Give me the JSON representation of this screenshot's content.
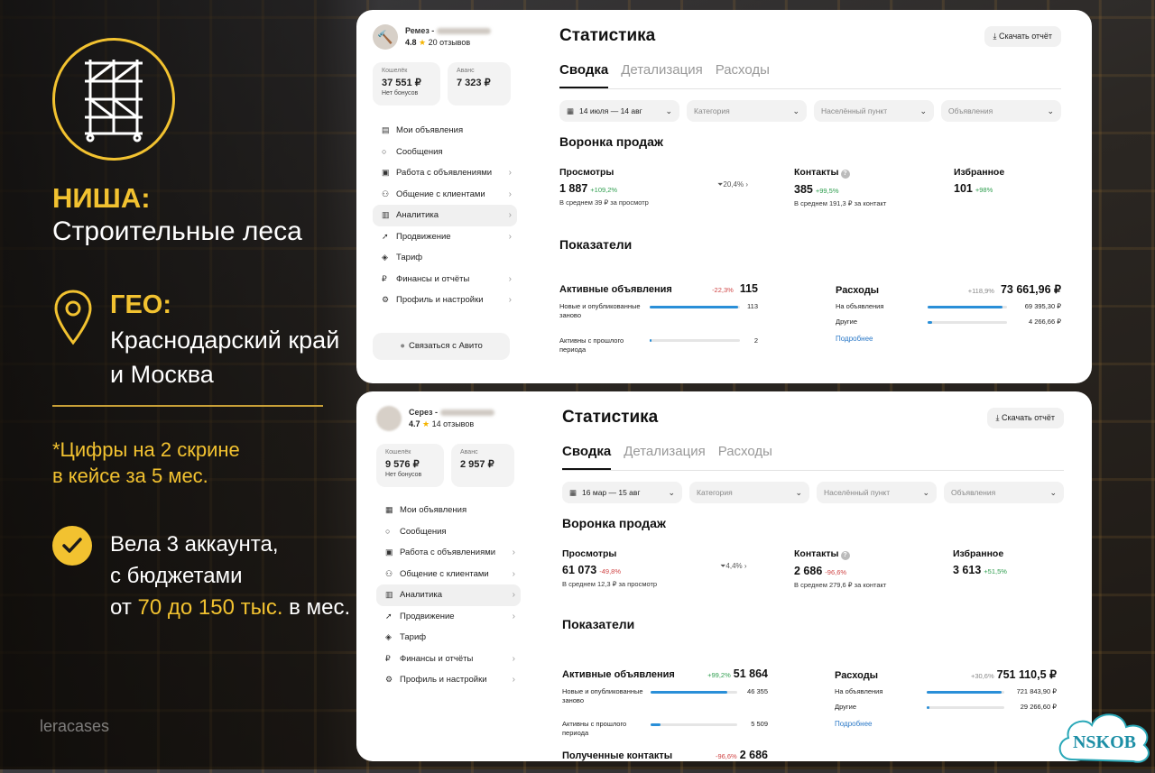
{
  "left": {
    "niche_title": "НИША:",
    "niche_text": "Строительные леса",
    "geo_title": "ГЕО:",
    "geo_line1": "Краснодарский край",
    "geo_line2": "и Москва",
    "note_line1": "*Цифры на 2 скрине",
    "note_line2": "в кейсе за 5 мес.",
    "acc_line1": "Вела 3 аккаунта,",
    "acc_line2": "с бюджетами",
    "acc_pre": "от",
    "acc_range": "70 до 150 тыс.",
    "acc_post": "в мес.",
    "brand": "leracases",
    "stamp": "NSKOB"
  },
  "colors": {
    "accent": "#f2c230",
    "link": "#2a78c7",
    "bar": "#2a8fd8",
    "positive": "#2f9e4f",
    "negative": "#d04545"
  },
  "card1": {
    "profile": {
      "name": "Ремез -",
      "rating": "4.8",
      "reviews": "20 отзывов"
    },
    "wallet": {
      "label": "Кошелёк",
      "value": "37 551 ₽",
      "sub": "Нет бонусов"
    },
    "advance": {
      "label": "Аванс",
      "value": "7 323 ₽"
    },
    "menu": [
      "Мои объявления",
      "Сообщения",
      "Работа с объявлениями",
      "Общение с клиентами",
      "Аналитика",
      "Продвижение",
      "Тариф",
      "Финансы и отчёты",
      "Профиль и настройки"
    ],
    "contact_button": "Связаться с Авито",
    "title": "Статистика",
    "download": "Скачать отчёт",
    "tabs": [
      "Сводка",
      "Детализация",
      "Расходы"
    ],
    "filters": {
      "date": "14 июля — 14 авг",
      "category": "Категория",
      "place": "Населённый пункт",
      "ads": "Объявления"
    },
    "funnel_title": "Воронка продаж",
    "views": {
      "label": "Просмотры",
      "value": "1 887",
      "delta": "+109,2%",
      "sub": "В среднем 39 ₽ за просмотр"
    },
    "conversion": "20,4%",
    "contacts": {
      "label": "Контакты",
      "value": "385",
      "delta": "+99,5%",
      "sub": "В среднем 191,3 ₽ за контакт"
    },
    "favorites": {
      "label": "Избранное",
      "value": "101",
      "delta": "+98%"
    },
    "indicators_title": "Показатели",
    "active": {
      "label": "Активные объявления",
      "delta": "-22,3%",
      "value": "115",
      "rows": [
        {
          "label": "Новые и опубликованные заново",
          "value": "113",
          "fill": 0.98
        },
        {
          "label": "Активны с прошлого периода",
          "value": "2",
          "fill": 0.02
        }
      ]
    },
    "expenses": {
      "label": "Расходы",
      "delta": "+118,9%",
      "value": "73 661,96 ₽",
      "rows": [
        {
          "label": "На объявления",
          "value": "69 395,30 ₽",
          "fill": 0.94
        },
        {
          "label": "Другие",
          "value": "4 266,66 ₽",
          "fill": 0.06
        }
      ],
      "more": "Подробнее"
    }
  },
  "card2": {
    "profile": {
      "name": "Серез -",
      "rating": "4.7",
      "reviews": "14 отзывов"
    },
    "wallet": {
      "label": "Кошелёк",
      "value": "9 576 ₽",
      "sub": "Нет бонусов"
    },
    "advance": {
      "label": "Аванс",
      "value": "2 957 ₽"
    },
    "menu": [
      "Мои объявления",
      "Сообщения",
      "Работа с объявлениями",
      "Общение с клиентами",
      "Аналитика",
      "Продвижение",
      "Тариф",
      "Финансы и отчёты",
      "Профиль и настройки"
    ],
    "title": "Статистика",
    "download": "Скачать отчёт",
    "tabs": [
      "Сводка",
      "Детализация",
      "Расходы"
    ],
    "filters": {
      "date": "16 мар — 15 авг",
      "category": "Категория",
      "place": "Населённый пункт",
      "ads": "Объявления"
    },
    "funnel_title": "Воронка продаж",
    "views": {
      "label": "Просмотры",
      "value": "61 073",
      "delta": "-49,8%",
      "sub": "В среднем 12,3 ₽ за просмотр"
    },
    "conversion": "4,4%",
    "contacts": {
      "label": "Контакты",
      "value": "2 686",
      "delta": "-96,6%",
      "sub": "В среднем 279,6 ₽ за контакт"
    },
    "favorites": {
      "label": "Избранное",
      "value": "3 613",
      "delta": "+51,5%"
    },
    "indicators_title": "Показатели",
    "active": {
      "label": "Активные объявления",
      "delta": "+99,2%",
      "value": "51 864",
      "rows": [
        {
          "label": "Новые и опубликованные заново",
          "value": "46 355",
          "fill": 0.89
        },
        {
          "label": "Активны с прошлого периода",
          "value": "5 509",
          "fill": 0.11
        }
      ]
    },
    "expenses": {
      "label": "Расходы",
      "delta": "+30,6%",
      "value": "751 110,5 ₽",
      "rows": [
        {
          "label": "На объявления",
          "value": "721 843,90 ₽",
          "fill": 0.96
        },
        {
          "label": "Другие",
          "value": "29 266,60 ₽",
          "fill": 0.04
        }
      ],
      "more": "Подробнее"
    },
    "received": {
      "label": "Полученные контакты",
      "delta": "-96,6%",
      "value": "2 686"
    }
  }
}
